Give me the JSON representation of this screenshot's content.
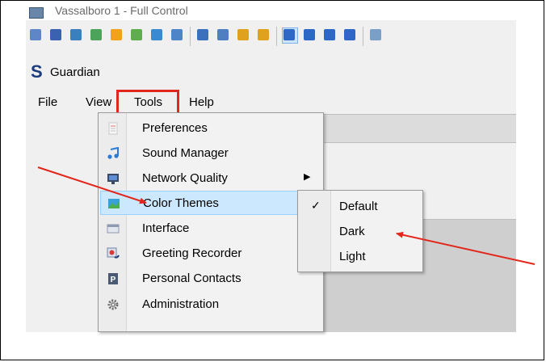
{
  "window": {
    "title": "Vassalboro 1 - Full Control"
  },
  "brand": {
    "logo": "S",
    "name": "Guardian"
  },
  "menubar": {
    "file": "File",
    "view": "View",
    "tools": "Tools",
    "help": "Help"
  },
  "tools_menu": {
    "items": [
      {
        "label": "Preferences",
        "icon": "preferences-icon"
      },
      {
        "label": "Sound Manager",
        "icon": "music-note-icon"
      },
      {
        "label": "Network Quality",
        "icon": "network-quality-icon"
      },
      {
        "label": "Color Themes",
        "icon": "color-themes-icon"
      },
      {
        "label": "Interface",
        "icon": "interface-icon"
      },
      {
        "label": "Greeting Recorder",
        "icon": "greeting-recorder-icon"
      },
      {
        "label": "Personal Contacts",
        "icon": "personal-contacts-icon"
      },
      {
        "label": "Administration",
        "icon": "gear-icon"
      }
    ],
    "arrow_glyph": "▶"
  },
  "color_themes_menu": {
    "check_glyph": "✓",
    "items": [
      {
        "label": "Default",
        "checked": true
      },
      {
        "label": "Dark",
        "checked": false
      },
      {
        "label": "Light",
        "checked": false
      }
    ]
  },
  "colors": {
    "highlight_box": "#e3261b",
    "annotation_arrow": "#e3261b",
    "menu_active": "#cce8ff"
  }
}
